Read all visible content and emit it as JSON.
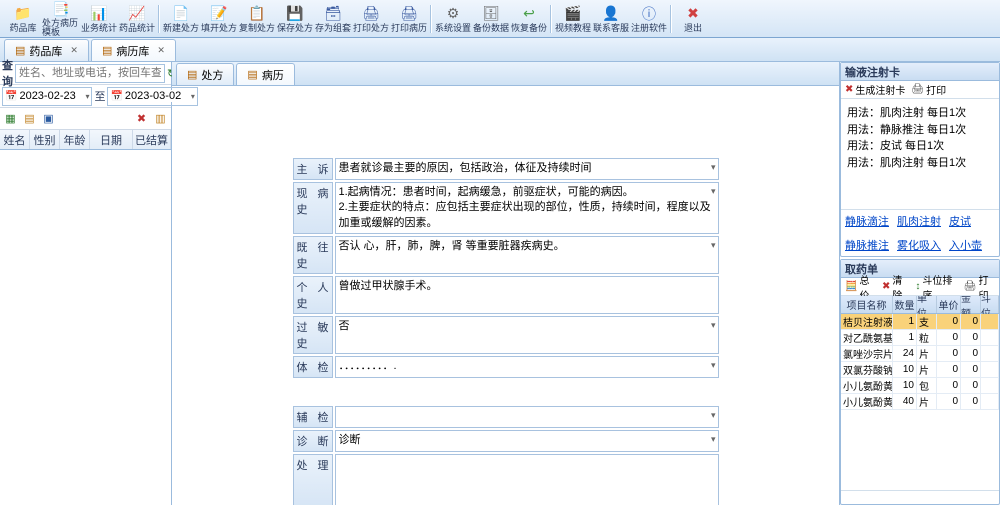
{
  "toolbar": [
    {
      "icon": "📁",
      "color": "#e4a43a",
      "label": "药品库"
    },
    {
      "icon": "📑",
      "color": "#e06c2e",
      "label": "处方病历模板"
    },
    {
      "icon": "📊",
      "color": "#5aa0e0",
      "label": "业务统计"
    },
    {
      "icon": "📈",
      "color": "#e06c9a",
      "label": "药品统计"
    },
    {
      "sep": true
    },
    {
      "icon": "📄",
      "color": "#4aa04a",
      "label": "新建处方"
    },
    {
      "icon": "📝",
      "color": "#4aa04a",
      "label": "填开处方"
    },
    {
      "icon": "📋",
      "color": "#4aa04a",
      "label": "复制处方"
    },
    {
      "icon": "💾",
      "color": "#3a5aa0",
      "label": "保存处方"
    },
    {
      "icon": "🗃",
      "color": "#3a5aa0",
      "label": "存为组套"
    },
    {
      "icon": "🖨",
      "color": "#3a5aa0",
      "label": "打印处方"
    },
    {
      "icon": "🖨",
      "color": "#3a5aa0",
      "label": "打印病历"
    },
    {
      "sep": true
    },
    {
      "icon": "⚙",
      "color": "#666",
      "label": "系统设置"
    },
    {
      "icon": "🗄",
      "color": "#666",
      "label": "备份数据"
    },
    {
      "icon": "↩",
      "color": "#4aa04a",
      "label": "恢复备份"
    },
    {
      "sep": true
    },
    {
      "icon": "🎬",
      "color": "#3a6ac0",
      "label": "视频教程"
    },
    {
      "icon": "👤",
      "color": "#3a6ac0",
      "label": "联系客服"
    },
    {
      "icon": "ⓘ",
      "color": "#3a6ac0",
      "label": "注册软件"
    },
    {
      "sep": true
    },
    {
      "icon": "✖",
      "color": "#d04040",
      "label": "退出"
    }
  ],
  "apptabs": [
    {
      "label": "药品库",
      "active": false
    },
    {
      "label": "病历库",
      "active": true
    }
  ],
  "left": {
    "search_label": "查询",
    "search_placeholder": "姓名、地址或电话，按回车查询",
    "refresh_icon": "↻",
    "date_from": "2023-02-23",
    "date_to": "2023-03-02",
    "date_mid": "至",
    "grid_cols": [
      "姓名",
      "性别",
      "年龄",
      "日期",
      "已结算"
    ]
  },
  "midtabs": [
    {
      "label": "处方",
      "active": false
    },
    {
      "label": "病历",
      "active": true
    }
  ],
  "form": {
    "rows": [
      {
        "label": "主  诉",
        "value": "患者就诊最主要的原因，包括政治，体征及持续时间",
        "dd": true
      },
      {
        "label": "现病史",
        "value": "1.起病情况：患者时间，起病缓急，前驱症状，可能的病因。\n2.主要症状的特点：应包括主要症状出现的部位，性质，持续时间，程度以及加重或缓解的因素。",
        "dd": true
      },
      {
        "label": "既往史",
        "value": "否认 心，肝，肺，脾，肾 等重要脏器疾病史。",
        "dd": true
      },
      {
        "label": "个人史",
        "value": "曾做过甲状腺手术。",
        "dd": false
      },
      {
        "label": "过敏史",
        "value": "否",
        "dd": true
      },
      {
        "label": "体  检",
        "value": "．．．．．．．．．.",
        "dd": true
      },
      {
        "gap": true
      },
      {
        "label": "辅  检",
        "value": "",
        "dd": true
      },
      {
        "label": "诊  断",
        "value": "诊断",
        "dd": true
      },
      {
        "label": "处  理",
        "value": "",
        "dd": false,
        "tall": true
      }
    ]
  },
  "card": {
    "title": "输液注射卡",
    "gen_label": "生成注射卡",
    "print_label": "打印",
    "lines": [
      "用法：肌肉注射   每日1次",
      "用法：静脉推注   每日1次",
      "用法：皮试  每日1次",
      "用法：肌肉注射   每日1次"
    ],
    "links": [
      "静脉滴注",
      "肌肉注射",
      "皮试",
      "静脉推注",
      "雾化吸入",
      "入小壶"
    ]
  },
  "medlist": {
    "title": "取药单",
    "tools": {
      "sum": "总价",
      "clear": "清除",
      "sort": "斗位排序",
      "print": "打印"
    },
    "cols": [
      "项目名称",
      "数量",
      "单位",
      "单价",
      "金额",
      "斗位"
    ],
    "rows": [
      {
        "name": "桔贝注射液",
        "qty": 1,
        "unit": "支",
        "price": 0,
        "amt": 0,
        "sel": true
      },
      {
        "name": "对乙酰氨基…",
        "qty": 1,
        "unit": "粒",
        "price": 0,
        "amt": 0
      },
      {
        "name": "氯唑沙宗片",
        "qty": 24,
        "unit": "片",
        "price": 0,
        "amt": 0
      },
      {
        "name": "双氯芬酸钠…",
        "qty": 10,
        "unit": "片",
        "price": 0,
        "amt": 0
      },
      {
        "name": "小儿氨酚黄…",
        "qty": 10,
        "unit": "包",
        "price": 0,
        "amt": 0
      },
      {
        "name": "小儿氨酚黄…",
        "qty": 40,
        "unit": "片",
        "price": 0,
        "amt": 0
      }
    ]
  }
}
